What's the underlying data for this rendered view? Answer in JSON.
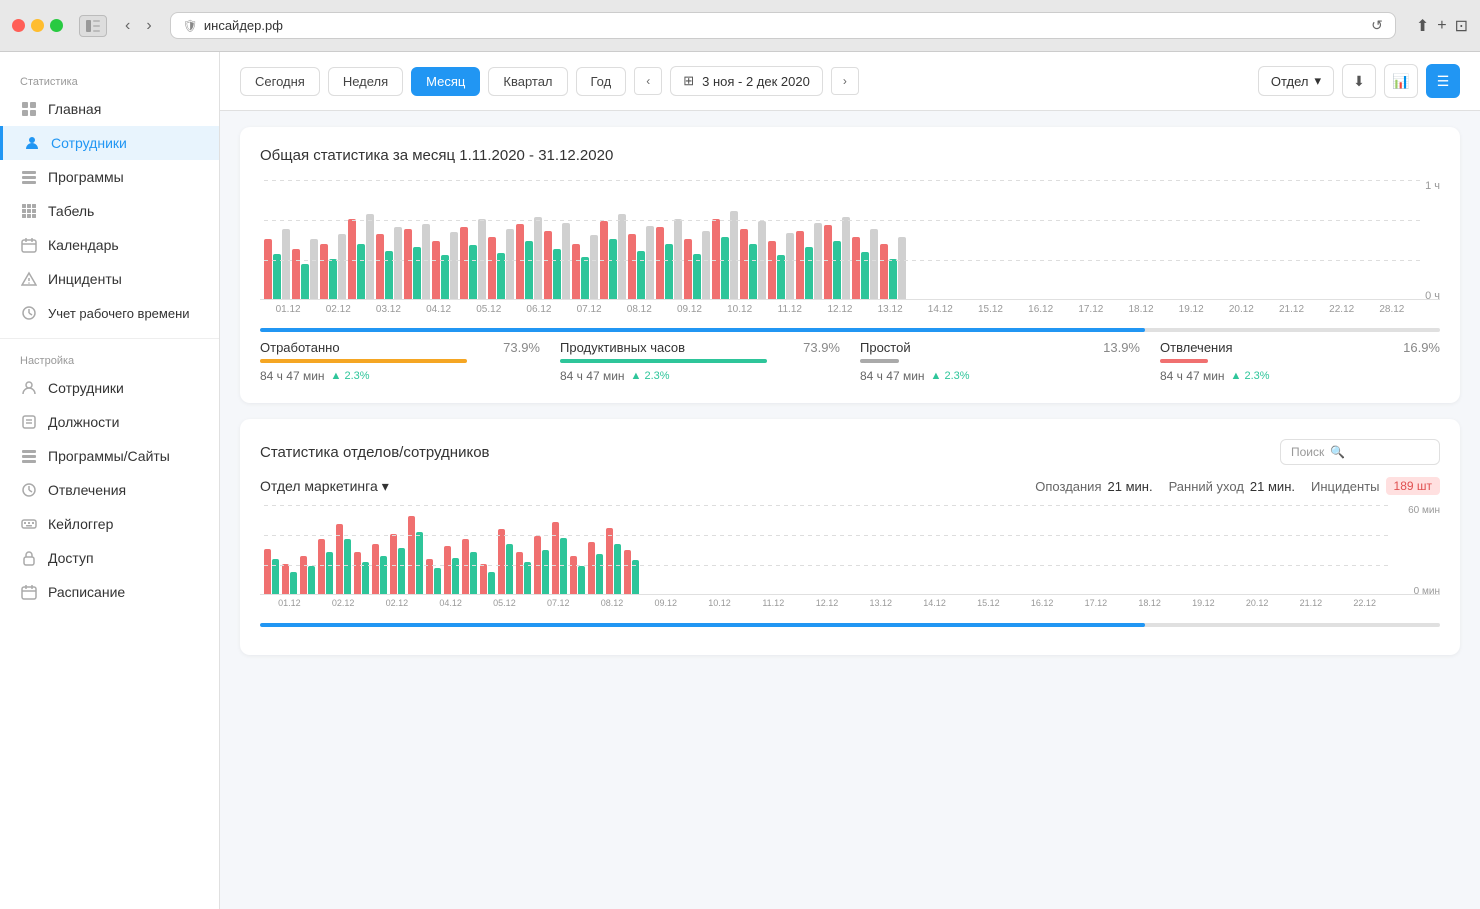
{
  "browser": {
    "url": "инсайдер.рф",
    "reload_btn": "↺"
  },
  "sidebar": {
    "section1_title": "Статистика",
    "section2_title": "Настройка",
    "items_stats": [
      {
        "id": "home",
        "label": "Главная",
        "icon": "home"
      },
      {
        "id": "employees",
        "label": "Сотрудники",
        "icon": "person",
        "active": true
      },
      {
        "id": "programs",
        "label": "Программы",
        "icon": "list"
      },
      {
        "id": "timesheet",
        "label": "Табель",
        "icon": "grid"
      },
      {
        "id": "calendar",
        "label": "Календарь",
        "icon": "calendar"
      },
      {
        "id": "incidents",
        "label": "Инциденты",
        "icon": "warning"
      },
      {
        "id": "worktime",
        "label": "Учет рабочего времени",
        "icon": "clock"
      }
    ],
    "items_settings": [
      {
        "id": "employees-s",
        "label": "Сотрудники",
        "icon": "person"
      },
      {
        "id": "positions",
        "label": "Должности",
        "icon": "briefcase"
      },
      {
        "id": "programs-sites",
        "label": "Программы/Сайты",
        "icon": "list"
      },
      {
        "id": "distractions",
        "label": "Отвлечения",
        "icon": "clock"
      },
      {
        "id": "keylogger",
        "label": "Кейлоггер",
        "icon": "keyboard"
      },
      {
        "id": "access",
        "label": "Доступ",
        "icon": "lock"
      },
      {
        "id": "schedule",
        "label": "Расписание",
        "icon": "calendar"
      }
    ]
  },
  "topbar": {
    "periods": [
      "Сегодня",
      "Неделя",
      "Месяц",
      "Квартал",
      "Год"
    ],
    "active_period": "Месяц",
    "date_range": "3 ноя - 2 дек 2020",
    "department": "Отдел",
    "download_icon": "⬇",
    "chart_icon": "📊",
    "menu_icon": "☰"
  },
  "general_stats": {
    "title": "Общая статистика за месяц 1.11.2020 - 31.12.2020",
    "y_axis_top": "1 ч",
    "y_axis_bottom": "0 ч",
    "bar_dates": [
      "01.12",
      "02.12",
      "03.12",
      "04.12",
      "05.12",
      "06.12",
      "07.12",
      "08.12",
      "09.12",
      "10.12",
      "11.12",
      "12.12",
      "13.12",
      "14.12",
      "15.12",
      "16.12",
      "17.12",
      "18.12",
      "19.12",
      "20.12",
      "21.12",
      "22.12",
      "28.12"
    ],
    "metrics": [
      {
        "name": "Отработанно",
        "pct": "73.9%",
        "bar_class": "yellow",
        "time": "84 ч 47 мин",
        "delta": "2.3%"
      },
      {
        "name": "Продуктивных часов",
        "pct": "73.9%",
        "bar_class": "green",
        "time": "84 ч 47 мин",
        "delta": "2.3%"
      },
      {
        "name": "Простой",
        "pct": "13.9%",
        "bar_class": "gray",
        "time": "84 ч 47 мин",
        "delta": "2.3%"
      },
      {
        "name": "Отвлечения",
        "pct": "16.9%",
        "bar_class": "red",
        "time": "84 ч 47 мин",
        "delta": "2.3%"
      }
    ]
  },
  "dept_stats": {
    "title": "Статистика отделов/сотрудников",
    "search_placeholder": "Поиск",
    "department": {
      "name": "Отдел маркетинга",
      "opozdan": "Опоздания",
      "opozdan_val": "21 мин.",
      "early": "Ранний уход",
      "early_val": "21 мин.",
      "incidents": "Инциденты",
      "incidents_val": "189 шт"
    },
    "y_axis_top": "60 мин",
    "y_axis_bottom": "0 мин",
    "bar_dates": [
      "01.12",
      "02.12",
      "02.12",
      "04.12",
      "05.12",
      "07.12",
      "08.12",
      "09.12",
      "10.12",
      "11.12",
      "12.12",
      "13.12",
      "14.12",
      "15.12",
      "16.12",
      "17.12",
      "18.12",
      "19.12",
      "20.12",
      "21.12",
      "22.12"
    ]
  }
}
